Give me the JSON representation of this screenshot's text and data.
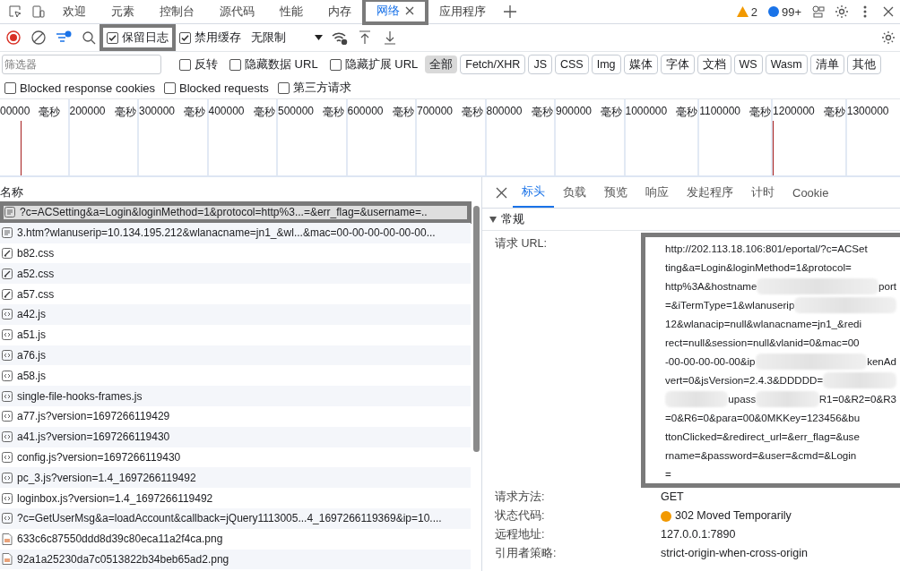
{
  "tabs": [
    {
      "label": "欢迎",
      "selected": false,
      "marked": false,
      "closable": false
    },
    {
      "label": "元素",
      "selected": false,
      "marked": false,
      "closable": false
    },
    {
      "label": "控制台",
      "selected": false,
      "marked": false,
      "closable": false
    },
    {
      "label": "源代码",
      "selected": false,
      "marked": false,
      "closable": false
    },
    {
      "label": "性能",
      "selected": false,
      "marked": false,
      "closable": false
    },
    {
      "label": "内存",
      "selected": false,
      "marked": false,
      "closable": false
    },
    {
      "label": "网络",
      "selected": true,
      "marked": true,
      "closable": true
    },
    {
      "label": "应用程序",
      "selected": false,
      "marked": false,
      "closable": false
    }
  ],
  "warnings": "2",
  "messages": "99+",
  "toolbar": {
    "recording": true,
    "preserve_log": {
      "label": "保留日志",
      "checked": true,
      "marked": true
    },
    "disable_cache": {
      "label": "禁用缓存",
      "checked": true
    },
    "throttling": "无限制"
  },
  "filter": {
    "placeholder": "筛选器",
    "options": [
      {
        "label": "反转",
        "checked": false
      },
      {
        "label": "隐藏数据 URL",
        "checked": false
      },
      {
        "label": "隐藏扩展 URL",
        "checked": false
      }
    ],
    "types": [
      {
        "label": "全部",
        "selected": true
      },
      {
        "label": "Fetch/XHR",
        "selected": false
      },
      {
        "label": "JS",
        "selected": false
      },
      {
        "label": "CSS",
        "selected": false
      },
      {
        "label": "Img",
        "selected": false
      },
      {
        "label": "媒体",
        "selected": false
      },
      {
        "label": "字体",
        "selected": false
      },
      {
        "label": "文档",
        "selected": false
      },
      {
        "label": "WS",
        "selected": false
      },
      {
        "label": "Wasm",
        "selected": false
      },
      {
        "label": "清单",
        "selected": false
      },
      {
        "label": "其他",
        "selected": false
      }
    ]
  },
  "blocking": [
    {
      "label": "Blocked response cookies",
      "checked": false
    },
    {
      "label": "Blocked requests",
      "checked": false
    },
    {
      "label": "第三方请求",
      "checked": false
    }
  ],
  "timeline": {
    "ticks": [
      {
        "value": "00000",
        "unit": "毫秒"
      },
      {
        "value": "200000",
        "unit": "毫秒"
      },
      {
        "value": "300000",
        "unit": "毫秒"
      },
      {
        "value": "400000",
        "unit": "毫秒"
      },
      {
        "value": "500000",
        "unit": "毫秒"
      },
      {
        "value": "600000",
        "unit": "毫秒"
      },
      {
        "value": "700000",
        "unit": "毫秒"
      },
      {
        "value": "800000",
        "unit": "毫秒"
      },
      {
        "value": "900000",
        "unit": "毫秒"
      },
      {
        "value": "1000000",
        "unit": "毫秒"
      },
      {
        "value": "1100000",
        "unit": "毫秒"
      },
      {
        "value": "1200000",
        "unit": "毫秒"
      },
      {
        "value": "1300000"
      }
    ]
  },
  "requests": {
    "column": "名称",
    "rows": [
      {
        "name": "?c=ACSetting&a=Login&loginMethod=1&protocol=http%3...=&err_flag=&username=..",
        "kind": "doc",
        "selected": true,
        "marked": true
      },
      {
        "name": "3.htm?wlanuserip=10.134.195.212&wlanacname=jn1_&wl...&mac=00-00-00-00-00-00...",
        "kind": "doc",
        "selected": false,
        "marked": false
      },
      {
        "name": "b82.css",
        "kind": "css",
        "selected": false,
        "marked": false
      },
      {
        "name": "a52.css",
        "kind": "css",
        "selected": false,
        "marked": false
      },
      {
        "name": "a57.css",
        "kind": "css",
        "selected": false,
        "marked": false
      },
      {
        "name": "a42.js",
        "kind": "js",
        "selected": false,
        "marked": false
      },
      {
        "name": "a51.js",
        "kind": "js",
        "selected": false,
        "marked": false
      },
      {
        "name": "a76.js",
        "kind": "js",
        "selected": false,
        "marked": false
      },
      {
        "name": "a58.js",
        "kind": "js",
        "selected": false,
        "marked": false
      },
      {
        "name": "single-file-hooks-frames.js",
        "kind": "js",
        "selected": false,
        "marked": false
      },
      {
        "name": "a77.js?version=1697266119429",
        "kind": "js",
        "selected": false,
        "marked": false
      },
      {
        "name": "a41.js?version=1697266119430",
        "kind": "js",
        "selected": false,
        "marked": false
      },
      {
        "name": "config.js?version=1697266119430",
        "kind": "js",
        "selected": false,
        "marked": false
      },
      {
        "name": "pc_3.js?version=1.4_1697266119492",
        "kind": "js",
        "selected": false,
        "marked": false
      },
      {
        "name": "loginbox.js?version=1.4_1697266119492",
        "kind": "js",
        "selected": false,
        "marked": false
      },
      {
        "name": "?c=GetUserMsg&a=loadAccount&callback=jQuery1113005...4_1697266119369&ip=10....",
        "kind": "js",
        "selected": false,
        "marked": false
      },
      {
        "name": "633c6c87550ddd8d39c80eca11a2f4ca.png",
        "kind": "image",
        "selected": false,
        "marked": false
      },
      {
        "name": "92a1a25230da7c0513822b34beb65ad2.png",
        "kind": "image",
        "selected": false,
        "marked": false
      }
    ]
  },
  "details": {
    "tabs": [
      {
        "label": "标头",
        "selected": true
      },
      {
        "label": "负载",
        "selected": false
      },
      {
        "label": "预览",
        "selected": false
      },
      {
        "label": "响应",
        "selected": false
      },
      {
        "label": "发起程序",
        "selected": false
      },
      {
        "label": "计时",
        "selected": false
      },
      {
        "label": "Cookie",
        "selected": false
      }
    ],
    "section": {
      "title": "常规",
      "expanded": true
    },
    "url": {
      "label": "请求 URL:",
      "marked": true,
      "lines": [
        [
          {
            "kind": "text",
            "text": "http://202.113.18.106:801/eportal/?c=ACSet"
          }
        ],
        [
          {
            "kind": "text",
            "text": "ting&a=Login&loginMethod=1&protocol="
          }
        ],
        [
          {
            "kind": "text",
            "text": "http%3A&hostname"
          },
          {
            "kind": "redacted"
          },
          {
            "kind": "text",
            "text": "port"
          }
        ],
        [
          {
            "kind": "text",
            "text": "=&iTermType=1&wlanuserip"
          },
          {
            "kind": "redacted"
          }
        ],
        [
          {
            "kind": "text",
            "text": "12&wlanacip=null&wlanacname=jn1_&redi"
          }
        ],
        [
          {
            "kind": "text",
            "text": "rect=null&session=null&vlanid=0&mac=00"
          }
        ],
        [
          {
            "kind": "text",
            "text": "-00-00-00-00-00&ip"
          },
          {
            "kind": "redacted"
          },
          {
            "kind": "text",
            "text": "kenAd"
          }
        ],
        [
          {
            "kind": "text",
            "text": "vert=0&jsVersion=2.4.3&DDDDD="
          },
          {
            "kind": "redacted"
          }
        ],
        [
          {
            "kind": "redacted"
          },
          {
            "kind": "text",
            "text": "upass"
          },
          {
            "kind": "redacted"
          },
          {
            "kind": "text",
            "text": "R1=0&R2=0&R3"
          }
        ],
        [
          {
            "kind": "text",
            "text": "=0&R6=0&para=00&0MKKey=123456&bu"
          }
        ],
        [
          {
            "kind": "text",
            "text": "ttonClicked=&redirect_url=&err_flag=&use"
          }
        ],
        [
          {
            "kind": "text",
            "text": "rname=&password=&user=&cmd=&Login"
          }
        ],
        [
          {
            "kind": "text",
            "text": "="
          }
        ]
      ]
    },
    "fields": [
      {
        "label": "请求方法:",
        "value": "GET"
      },
      {
        "label": "状态代码:",
        "value": "302 Moved Temporarily",
        "color": "#f29900"
      },
      {
        "label": "远程地址:",
        "value": "127.0.0.1:7890"
      },
      {
        "label": "引用者策略:",
        "value": "strict-origin-when-cross-origin"
      }
    ]
  }
}
